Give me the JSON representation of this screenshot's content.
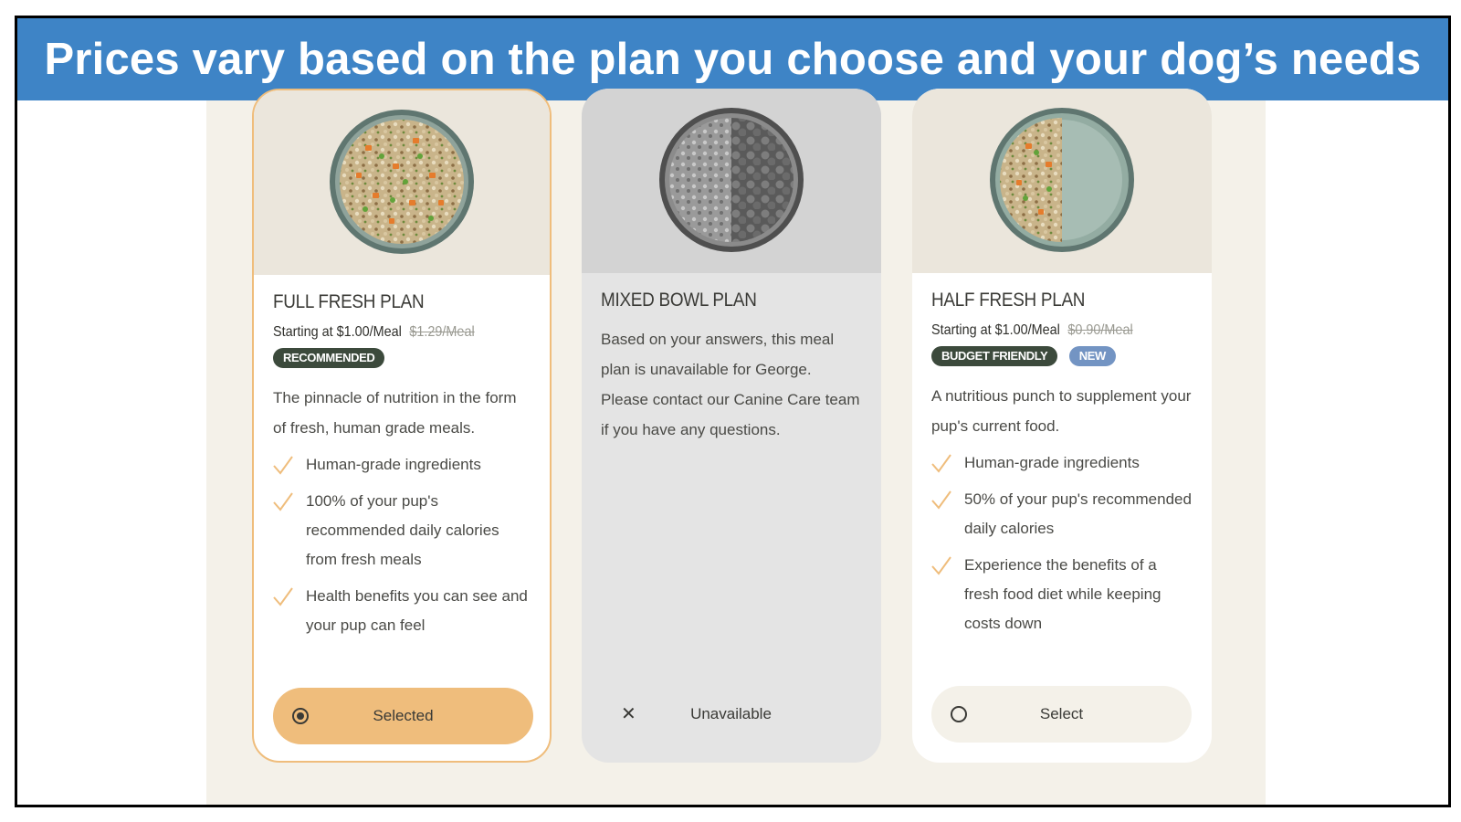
{
  "banner": {
    "title": "Prices vary based on the plan you choose and your dog’s needs"
  },
  "plans": [
    {
      "title": "FULL FRESH PLAN",
      "price": "Starting at $1.00/Meal",
      "old_price": "$1.29/Meal",
      "badges": [
        "RECOMMENDED"
      ],
      "description": "The pinnacle of nutrition in the form of fresh, human grade meals.",
      "features": [
        "Human-grade ingredients",
        "100% of your pup's recommended daily calories from fresh meals",
        "Health benefits you can see and your pup can feel"
      ],
      "button_label": "Selected",
      "state": "selected"
    },
    {
      "title": "MIXED BOWL PLAN",
      "message": "Based on your answers, this meal plan is unavailable for George. Please contact our Canine Care team if you have any questions.",
      "button_label": "Unavailable",
      "state": "unavailable"
    },
    {
      "title": "HALF FRESH PLAN",
      "price": "Starting at $1.00/Meal",
      "old_price": "$0.90/Meal",
      "badges": [
        "BUDGET FRIENDLY",
        "NEW"
      ],
      "description": "A nutritious punch to supplement your pup's current food.",
      "features": [
        "Human-grade ingredients",
        "50% of your pup's recommended daily calories",
        "Experience the benefits of a fresh food diet while keeping costs down"
      ],
      "button_label": "Select",
      "state": "unselected"
    }
  ],
  "colors": {
    "banner": "#3e84c6",
    "accent": "#efbd7c",
    "badge_dark": "#3c4a3c",
    "badge_blue": "#7394c3"
  },
  "icons": {
    "check": "checkmark-icon",
    "close": "close-icon",
    "radio_on": "radio-selected-icon",
    "radio_off": "radio-empty-icon"
  }
}
